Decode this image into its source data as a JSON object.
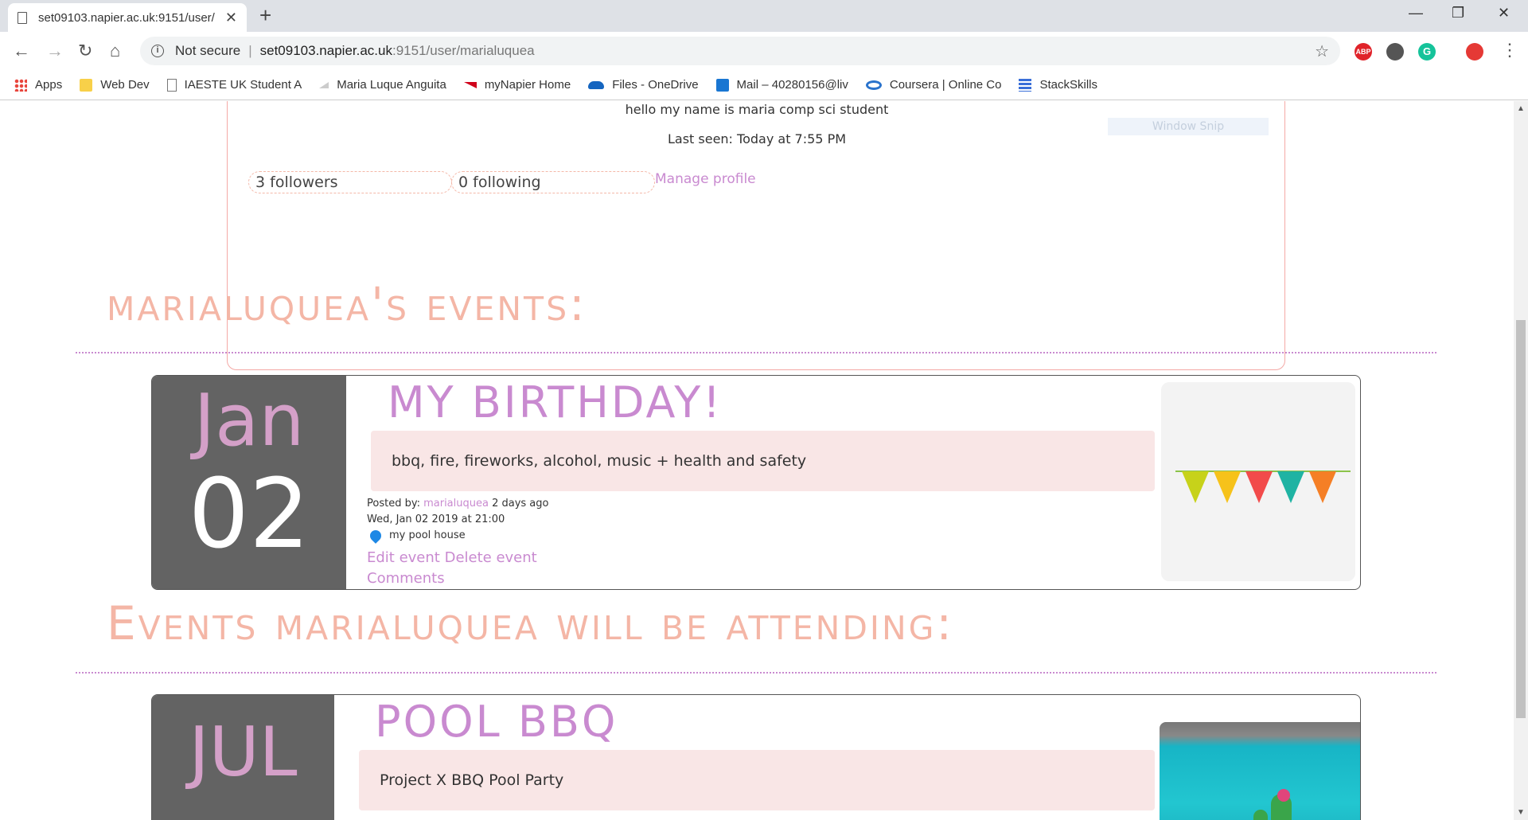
{
  "browser": {
    "tab_title": "set09103.napier.ac.uk:9151/user/",
    "tab_close": "✕",
    "new_tab": "+",
    "window_controls": [
      "—",
      "❐",
      "✕"
    ],
    "nav": {
      "back": "←",
      "forward": "→",
      "reload": "↻",
      "home": "⌂"
    },
    "url": {
      "security": "Not secure",
      "host": "set09103.napier.ac.uk",
      "path": ":9151/user/marialuquea"
    },
    "star": "☆",
    "menu": "⋮",
    "extensions": [
      {
        "name": "adblock-icon",
        "text": "ABP",
        "color": "#e0232a"
      },
      {
        "name": "extension-icon",
        "text": "",
        "color": "#555555"
      },
      {
        "name": "grammarly-icon",
        "text": "G",
        "color": "#15c39a"
      },
      {
        "name": "profile-icon",
        "text": "",
        "color": "#e53935"
      }
    ]
  },
  "bookmarks": [
    {
      "label": "Apps",
      "icon": "apps-grid-icon",
      "color": "#e8453c"
    },
    {
      "label": "Web Dev",
      "icon": "folder-icon",
      "color": "#f8d049"
    },
    {
      "label": "IAESTE UK Student A",
      "icon": "page-icon",
      "color": "#777777"
    },
    {
      "label": "Maria Luque Anguita",
      "icon": "paperplane-icon",
      "color": "#bbbbbb"
    },
    {
      "label": "myNapier Home",
      "icon": "napier-icon",
      "color": "#d0021b"
    },
    {
      "label": "Files - OneDrive",
      "icon": "onedrive-icon",
      "color": "#1565c0"
    },
    {
      "label": "Mail – 40280156@liv",
      "icon": "outlook-icon",
      "color": "#1976d2"
    },
    {
      "label": "Coursera | Online Co",
      "icon": "coursera-icon",
      "color": "#2a73cc"
    },
    {
      "label": "StackSkills",
      "icon": "stackskills-icon",
      "color": "#3a6fd8"
    }
  ],
  "profile": {
    "bio": "hello my name is maria comp sci student",
    "last_seen": "Last seen: Today at 7:55 PM",
    "followers": "3 followers",
    "following": "0 following",
    "manage": "Manage profile",
    "window_snip": "Window Snip"
  },
  "sections": {
    "my_events": "marialuquea's events:",
    "attending": "Events marialuquea will be attending:"
  },
  "events": [
    {
      "month": "Jan",
      "day": "02",
      "title": "MY BIRTHDAY!",
      "description": "bbq, fire, fireworks, alcohol, music + health and safety",
      "posted_by_label": "Posted by: ",
      "posted_by_user": "marialuquea",
      "posted_ago": " 2 days ago",
      "datetime": "Wed, Jan 02 2019 at 21:00",
      "location": "my pool house",
      "edit": "Edit event",
      "delete": "Delete event",
      "comments": "Comments"
    },
    {
      "month": "JUL",
      "title": "POOL BBQ",
      "description": "Project X BBQ Pool Party"
    }
  ]
}
